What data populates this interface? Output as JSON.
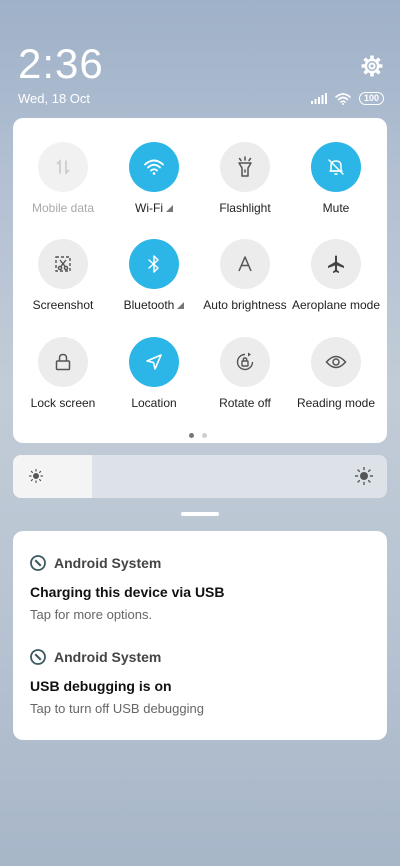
{
  "status": {
    "time": "2:36",
    "date": "Wed, 18 Oct",
    "battery": "100"
  },
  "quick_settings": {
    "tiles": [
      {
        "label": "Mobile data",
        "icon": "mobile-data-icon",
        "state": "disabled"
      },
      {
        "label": "Wi-Fi",
        "icon": "wifi-icon",
        "state": "on",
        "expandable": true
      },
      {
        "label": "Flashlight",
        "icon": "flashlight-icon",
        "state": "off"
      },
      {
        "label": "Mute",
        "icon": "mute-bell-icon",
        "state": "on"
      },
      {
        "label": "Screenshot",
        "icon": "screenshot-icon",
        "state": "off"
      },
      {
        "label": "Bluetooth",
        "icon": "bluetooth-icon",
        "state": "on",
        "expandable": true
      },
      {
        "label": "Auto brightness",
        "icon": "auto-brightness-icon",
        "state": "off"
      },
      {
        "label": "Aeroplane mode",
        "icon": "aeroplane-icon",
        "state": "off"
      },
      {
        "label": "Lock screen",
        "icon": "lock-icon",
        "state": "off"
      },
      {
        "label": "Location",
        "icon": "location-arrow-icon",
        "state": "on"
      },
      {
        "label": "Rotate off",
        "icon": "rotate-lock-icon",
        "state": "off"
      },
      {
        "label": "Reading mode",
        "icon": "eye-icon",
        "state": "off"
      }
    ],
    "page_count": 2,
    "active_page": 0
  },
  "brightness": {
    "level_percent": 21
  },
  "notifications": [
    {
      "app": "Android System",
      "title": "Charging this device via USB",
      "text": "Tap for more options."
    },
    {
      "app": "Android System",
      "title": "USB debugging is on",
      "text": "Tap to turn off USB debugging"
    }
  ],
  "colors": {
    "accent": "#2cb6e7",
    "tile_off": "#ececec"
  }
}
